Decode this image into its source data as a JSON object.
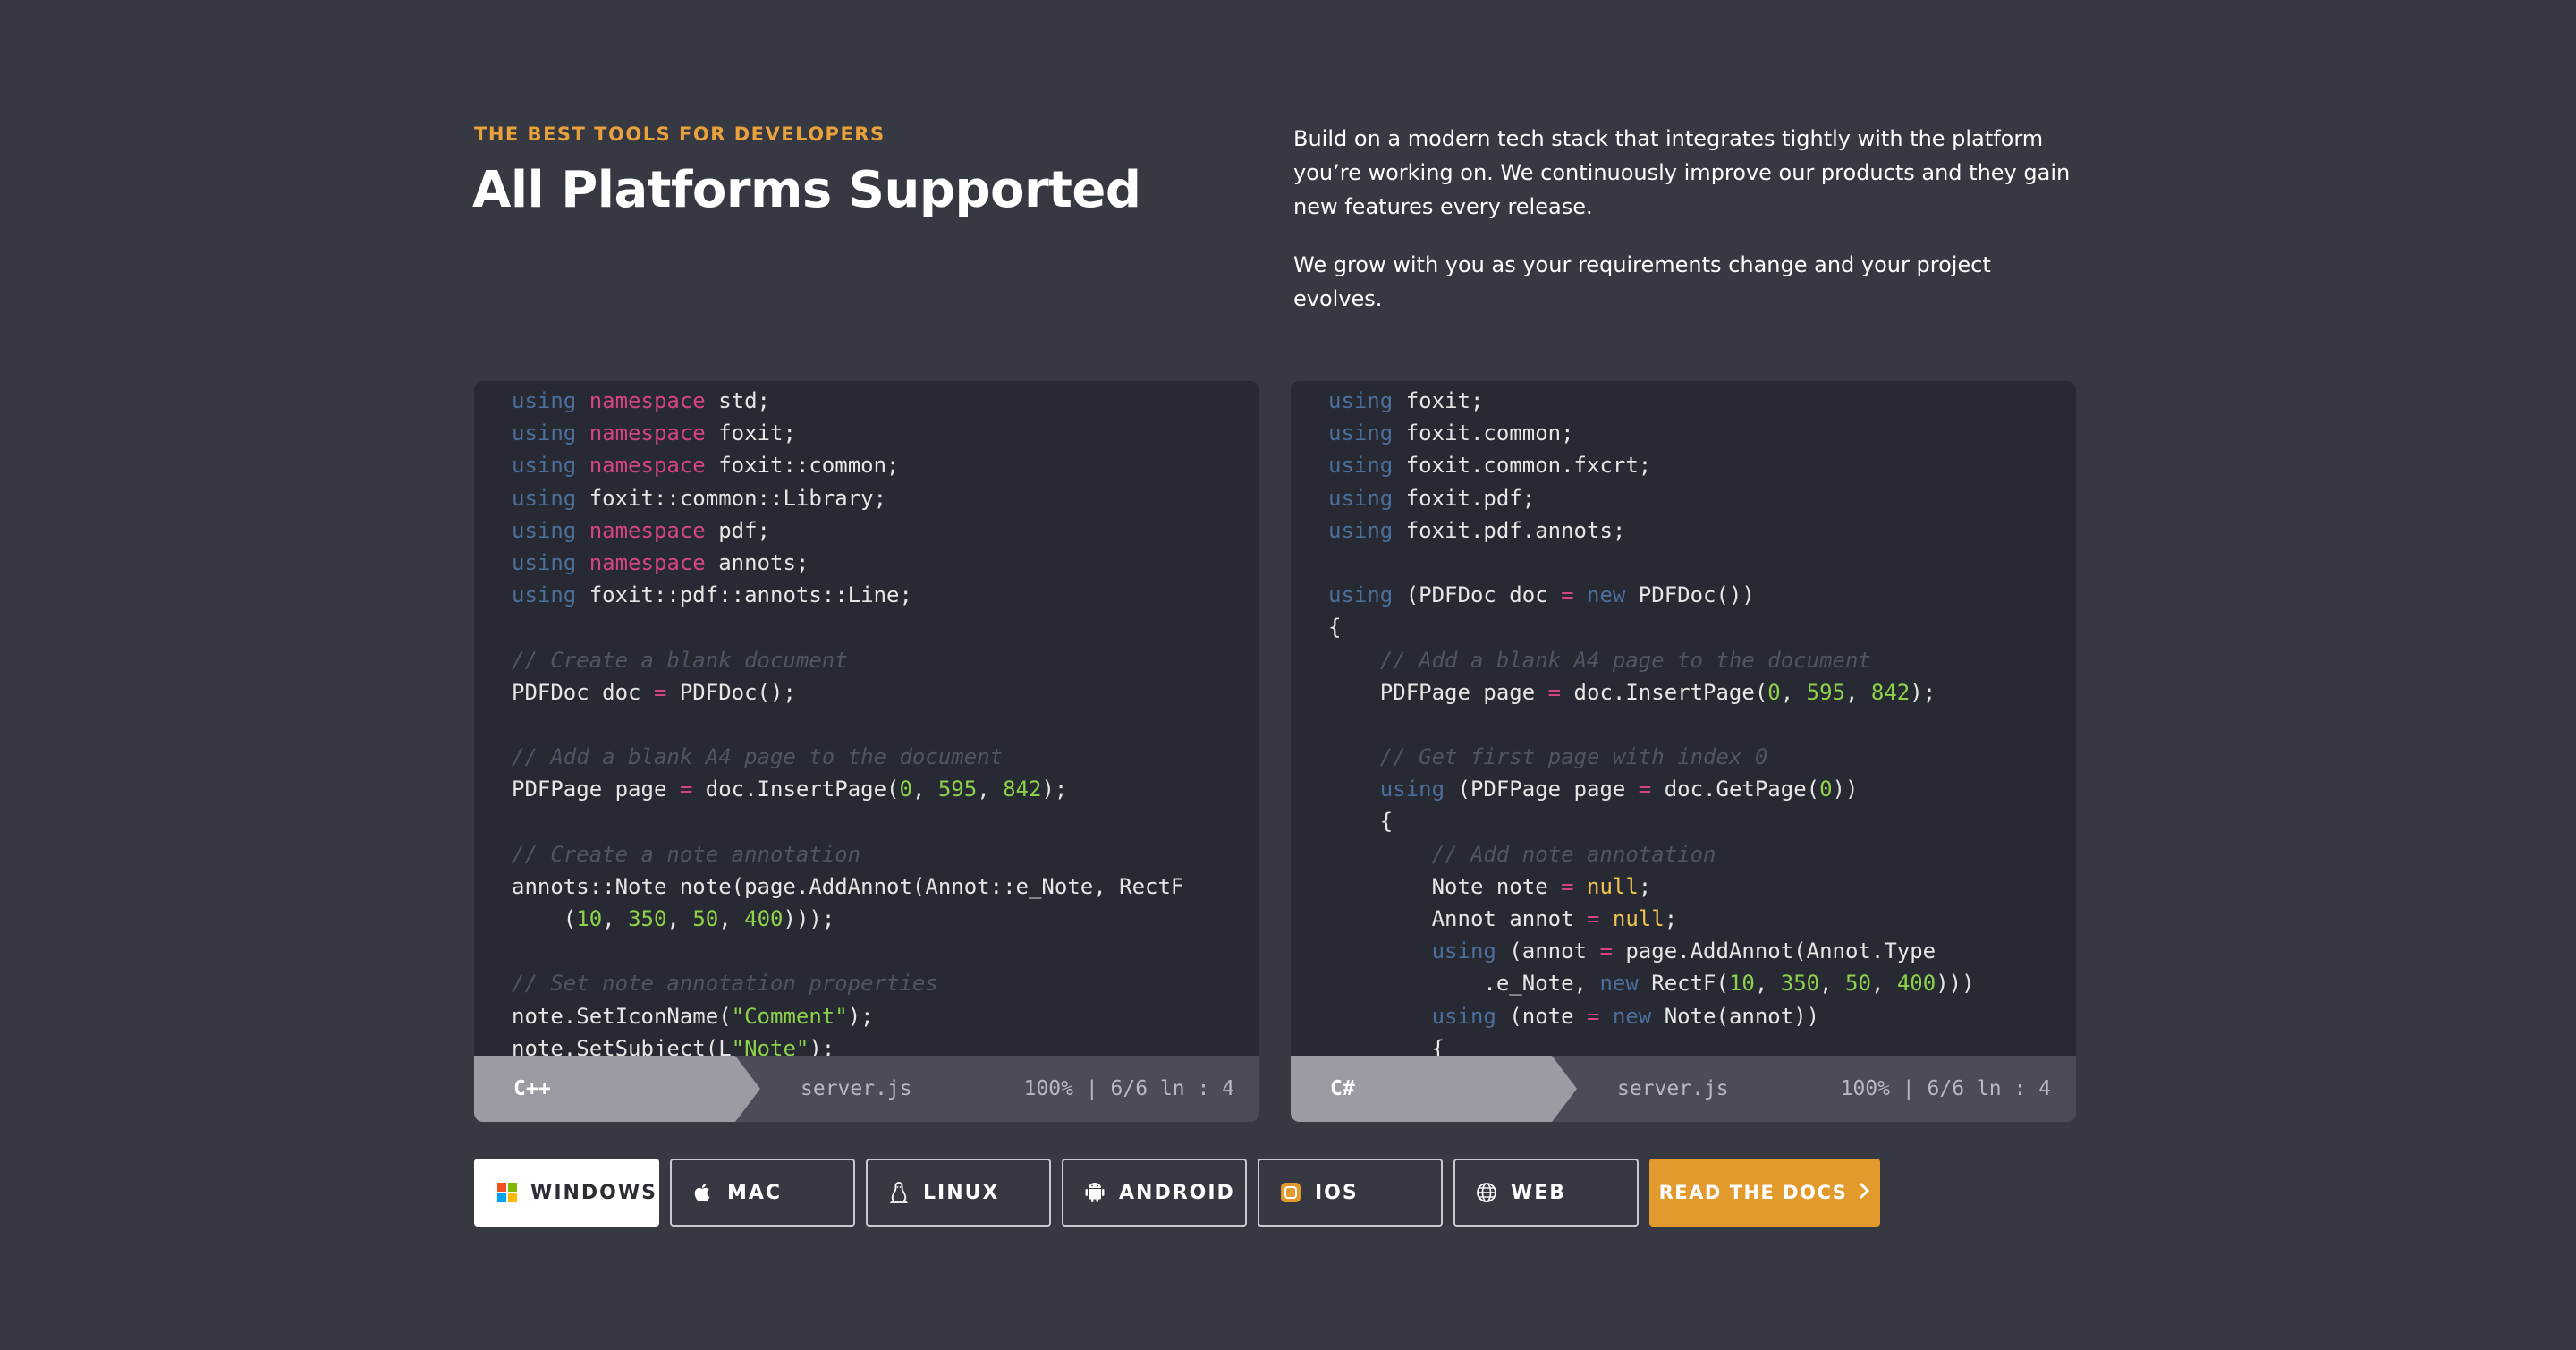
{
  "header": {
    "eyebrow": "THE BEST TOOLS FOR DEVELOPERS",
    "title": "All Platforms Supported",
    "paragraph_1": "Build on a modern tech stack that integrates tightly with the platform you’re working on. We continuously improve our products and they gain new features every release.",
    "paragraph_2": "We grow with you as your requirements change and your project evolves."
  },
  "cpp_panel": {
    "lines": [
      [
        [
          "kw",
          "using"
        ],
        [
          "t",
          " "
        ],
        [
          "ns",
          "namespace"
        ],
        [
          "t",
          " std;"
        ]
      ],
      [
        [
          "kw",
          "using"
        ],
        [
          "t",
          " "
        ],
        [
          "ns",
          "namespace"
        ],
        [
          "t",
          " foxit;"
        ]
      ],
      [
        [
          "kw",
          "using"
        ],
        [
          "t",
          " "
        ],
        [
          "ns",
          "namespace"
        ],
        [
          "t",
          " foxit::common;"
        ]
      ],
      [
        [
          "kw",
          "using"
        ],
        [
          "t",
          " foxit::common::Library;"
        ]
      ],
      [
        [
          "kw",
          "using"
        ],
        [
          "t",
          " "
        ],
        [
          "ns",
          "namespace"
        ],
        [
          "t",
          " pdf;"
        ]
      ],
      [
        [
          "kw",
          "using"
        ],
        [
          "t",
          " "
        ],
        [
          "ns",
          "namespace"
        ],
        [
          "t",
          " annots;"
        ]
      ],
      [
        [
          "kw",
          "using"
        ],
        [
          "t",
          " foxit::pdf::annots::Line;"
        ]
      ],
      [],
      [
        [
          "com",
          "// Create a blank document"
        ]
      ],
      [
        [
          "t",
          "PDFDoc doc "
        ],
        [
          "op",
          "="
        ],
        [
          "t",
          " PDFDoc();"
        ]
      ],
      [],
      [
        [
          "com",
          "// Add a blank A4 page to the document"
        ]
      ],
      [
        [
          "t",
          "PDFPage page "
        ],
        [
          "op",
          "="
        ],
        [
          "t",
          " doc.InsertPage("
        ],
        [
          "num",
          "0"
        ],
        [
          "t",
          ", "
        ],
        [
          "num",
          "595"
        ],
        [
          "t",
          ", "
        ],
        [
          "num",
          "842"
        ],
        [
          "t",
          ");"
        ]
      ],
      [],
      [
        [
          "com",
          "// Create a note annotation"
        ]
      ],
      [
        [
          "t",
          "annots::Note note(page.AddAnnot(Annot::e_Note, RectF"
        ]
      ],
      [
        [
          "t",
          "    ("
        ],
        [
          "num",
          "10"
        ],
        [
          "t",
          ", "
        ],
        [
          "num",
          "350"
        ],
        [
          "t",
          ", "
        ],
        [
          "num",
          "50"
        ],
        [
          "t",
          ", "
        ],
        [
          "num",
          "400"
        ],
        [
          "t",
          ")));"
        ]
      ],
      [],
      [
        [
          "com",
          "// Set note annotation properties"
        ]
      ],
      [
        [
          "t",
          "note.SetIconName("
        ],
        [
          "str",
          "\"Comment\""
        ],
        [
          "t",
          ");"
        ]
      ],
      [
        [
          "t",
          "note.SetSubject(L"
        ],
        [
          "str",
          "\"Note\""
        ],
        [
          "t",
          ");"
        ]
      ]
    ],
    "status": {
      "language": "C++",
      "file": "server.js",
      "position": "100% | 6/6 ln : 4"
    }
  },
  "csharp_panel": {
    "lines": [
      [
        [
          "kw",
          "using"
        ],
        [
          "t",
          " foxit;"
        ]
      ],
      [
        [
          "kw",
          "using"
        ],
        [
          "t",
          " foxit.common;"
        ]
      ],
      [
        [
          "kw",
          "using"
        ],
        [
          "t",
          " foxit.common.fxcrt;"
        ]
      ],
      [
        [
          "kw",
          "using"
        ],
        [
          "t",
          " foxit.pdf;"
        ]
      ],
      [
        [
          "kw",
          "using"
        ],
        [
          "t",
          " foxit.pdf.annots;"
        ]
      ],
      [],
      [
        [
          "kw",
          "using"
        ],
        [
          "t",
          " (PDFDoc doc "
        ],
        [
          "op",
          "="
        ],
        [
          "t",
          " "
        ],
        [
          "kw",
          "new"
        ],
        [
          "t",
          " PDFDoc())"
        ]
      ],
      [
        [
          "t",
          "{"
        ]
      ],
      [
        [
          "t",
          "    "
        ],
        [
          "com",
          "// Add a blank A4 page to the document"
        ]
      ],
      [
        [
          "t",
          "    PDFPage page "
        ],
        [
          "op",
          "="
        ],
        [
          "t",
          " doc.InsertPage("
        ],
        [
          "num",
          "0"
        ],
        [
          "t",
          ", "
        ],
        [
          "num",
          "595"
        ],
        [
          "t",
          ", "
        ],
        [
          "num",
          "842"
        ],
        [
          "t",
          ");"
        ]
      ],
      [],
      [
        [
          "t",
          "    "
        ],
        [
          "com",
          "// Get first page with index 0"
        ]
      ],
      [
        [
          "t",
          "    "
        ],
        [
          "kw",
          "using"
        ],
        [
          "t",
          " (PDFPage page "
        ],
        [
          "op",
          "="
        ],
        [
          "t",
          " doc.GetPage("
        ],
        [
          "num",
          "0"
        ],
        [
          "t",
          "))"
        ]
      ],
      [
        [
          "t",
          "    {"
        ]
      ],
      [
        [
          "t",
          "        "
        ],
        [
          "com",
          "// Add note annotation"
        ]
      ],
      [
        [
          "t",
          "        Note note "
        ],
        [
          "op",
          "="
        ],
        [
          "t",
          " "
        ],
        [
          "null",
          "null"
        ],
        [
          "t",
          ";"
        ]
      ],
      [
        [
          "t",
          "        Annot annot "
        ],
        [
          "op",
          "="
        ],
        [
          "t",
          " "
        ],
        [
          "null",
          "null"
        ],
        [
          "t",
          ";"
        ]
      ],
      [
        [
          "t",
          "        "
        ],
        [
          "kw",
          "using"
        ],
        [
          "t",
          " (annot "
        ],
        [
          "op",
          "="
        ],
        [
          "t",
          " page.AddAnnot(Annot.Type"
        ]
      ],
      [
        [
          "t",
          "            .e_Note, "
        ],
        [
          "kw",
          "new"
        ],
        [
          "t",
          " RectF("
        ],
        [
          "num",
          "10"
        ],
        [
          "t",
          ", "
        ],
        [
          "num",
          "350"
        ],
        [
          "t",
          ", "
        ],
        [
          "num",
          "50"
        ],
        [
          "t",
          ", "
        ],
        [
          "num",
          "400"
        ],
        [
          "t",
          ")))"
        ]
      ],
      [
        [
          "t",
          "        "
        ],
        [
          "kw",
          "using"
        ],
        [
          "t",
          " (note "
        ],
        [
          "op",
          "="
        ],
        [
          "t",
          " "
        ],
        [
          "kw",
          "new"
        ],
        [
          "t",
          " Note(annot))"
        ]
      ],
      [
        [
          "t",
          "        {"
        ]
      ]
    ],
    "status": {
      "language": "C#",
      "file": "server.js",
      "position": "100% | 6/6 ln : 4"
    }
  },
  "platforms": [
    {
      "label": "WINDOWS",
      "icon": "windows-icon",
      "active": true
    },
    {
      "label": "MAC",
      "icon": "apple-icon",
      "active": false
    },
    {
      "label": "LINUX",
      "icon": "linux-icon",
      "active": false
    },
    {
      "label": "ANDROID",
      "icon": "android-icon",
      "active": false
    },
    {
      "label": "IOS",
      "icon": "ios-icon",
      "active": false
    },
    {
      "label": "WEB",
      "icon": "globe-icon",
      "active": false
    }
  ],
  "docs_button": {
    "label": "READ THE DOCS"
  },
  "colors": {
    "background": "#363842",
    "code_background": "#272a33",
    "accent": "#e29a2c",
    "keyword": "#4b6e9a",
    "namespace": "#d6447f",
    "number": "#8ed14a",
    "null": "#f2c44e"
  }
}
